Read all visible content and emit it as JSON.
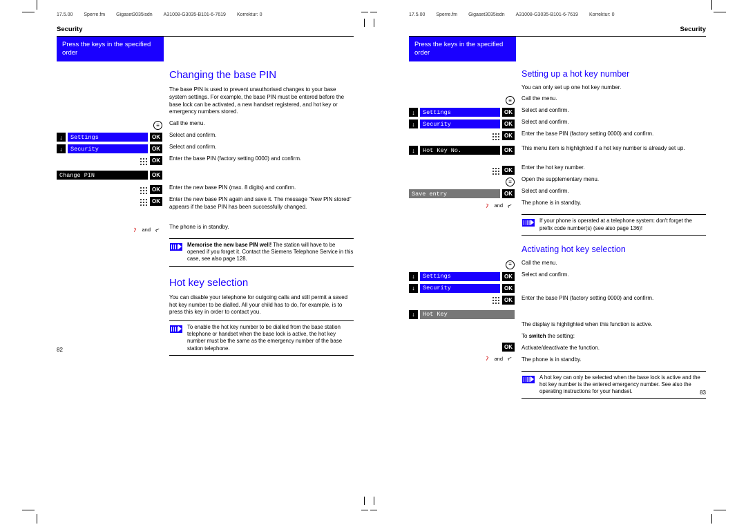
{
  "header": {
    "date": "17.5.00",
    "file": "Sperre.fm",
    "model": "Gigaset3035isdn",
    "doc": "A31008-G3035-B101-6-7619",
    "korr": "Korrektur: 0"
  },
  "common": {
    "section": "Security",
    "banner": "Press the keys in the specified order",
    "ok": "OK",
    "and": "and"
  },
  "lcd": {
    "settings": "Settings",
    "security": "Security",
    "changepin": "Change PIN",
    "hotkeyno": "Hot Key No.",
    "saveentry": "Save entry",
    "hotkey": "Hot Key"
  },
  "p82": {
    "num": "82",
    "h1": "Changing the base PIN",
    "intro": "The base PIN is used to prevent unauthorised changes to your base system settings. For example, the base PIN must be entered before the base lock can be activated, a new handset registered, and hot key or emergency numbers stored.",
    "s_callmenu": "Call the menu.",
    "s_selconf": "Select and confirm.",
    "s_enterpin": "Enter the base PIN (factory setting 0000) and confirm.",
    "s_enternew": "Enter the new base PIN (max. 8 digits) and confirm.",
    "s_enteragain": "Enter the new base PIN again and save it. The message “New PIN stored” appears if the base PIN has been successfully changed.",
    "s_standby": "The phone is in standby.",
    "note1_b": "Memorise the new base PIN well!",
    "note1": " The station will have to be opened if you forget it. Contact the Siemens Telephone Service in this case, see also page 128.",
    "h2": "Hot key selection",
    "hk_intro": "You can disable your telephone for outgoing calls and still permit a saved hot key number to be dialled. All your child has to do, for example, is to press this key in order to contact you.",
    "hk_note": "To enable the hot key number to be dialled from the base station telephone or handset when the base lock is active, the hot key number must be the same as the emergency number of the base station telephone."
  },
  "p83": {
    "num": "83",
    "h1": "Setting up a hot key number",
    "intro": "You can only set up one hot key number.",
    "s_callmenu": "Call the menu.",
    "s_selconf": "Select and confirm.",
    "s_enterpin": "Enter the base PIN (factory setting 0000) and confirm.",
    "s_highl": "This menu item is highlighted if a hot key number is already set up.",
    "s_enterhk": "Enter the hot key number.",
    "s_opensupp": "Open the supplementary menu.",
    "s_standby": "The phone is in standby.",
    "note1": "If your phone is operated at a telephone system: don't forget the prefix code number(s) (see also page 136)!",
    "h2": "Activating hot key selection",
    "a_dispact": "The display is highlighted when this function is active.",
    "a_toswitch_pre": "To ",
    "a_toswitch_b": "switch",
    "a_toswitch_post": " the setting:",
    "a_actdeact": "Activate/deactivate the function.",
    "note2": "A hot key can only be selected when the base lock is active and the hot key number is the entered emergency number. See also the operating instructions for your handset."
  }
}
